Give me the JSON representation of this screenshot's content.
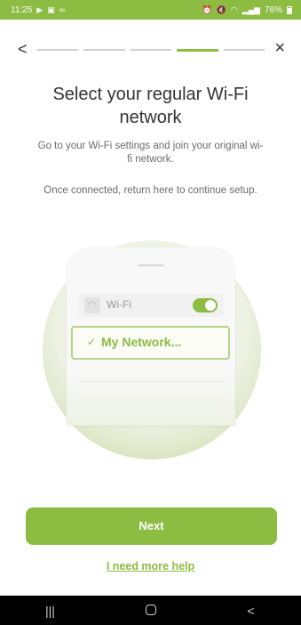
{
  "status_bar": {
    "time": "11:25",
    "left_icons": [
      "app-notification-icon",
      "image-icon",
      "link-icon"
    ],
    "right_icons": [
      "alarm-icon",
      "mute-icon",
      "wifi-signal-icon",
      "cell-signal-icon"
    ],
    "battery": "76%"
  },
  "nav": {
    "back_label": "<",
    "close_label": "×",
    "steps": 5,
    "active_step": 4
  },
  "title": "Select your regular Wi-Fi network",
  "description": {
    "line1": "Go to your Wi-Fi settings and join your original wi-fi network.",
    "line2": "Once connected, return here to continue setup."
  },
  "illustration": {
    "wifi_label": "Wi-Fi",
    "network_label": "My Network...",
    "check_mark": "✓"
  },
  "buttons": {
    "next": "Next",
    "help": "I need more help"
  },
  "system_nav": {
    "recent": "|||",
    "home": "",
    "back": "<"
  },
  "colors": {
    "accent": "#8cbc42",
    "text_dark": "#333333",
    "text_muted": "#6b6b6b"
  }
}
